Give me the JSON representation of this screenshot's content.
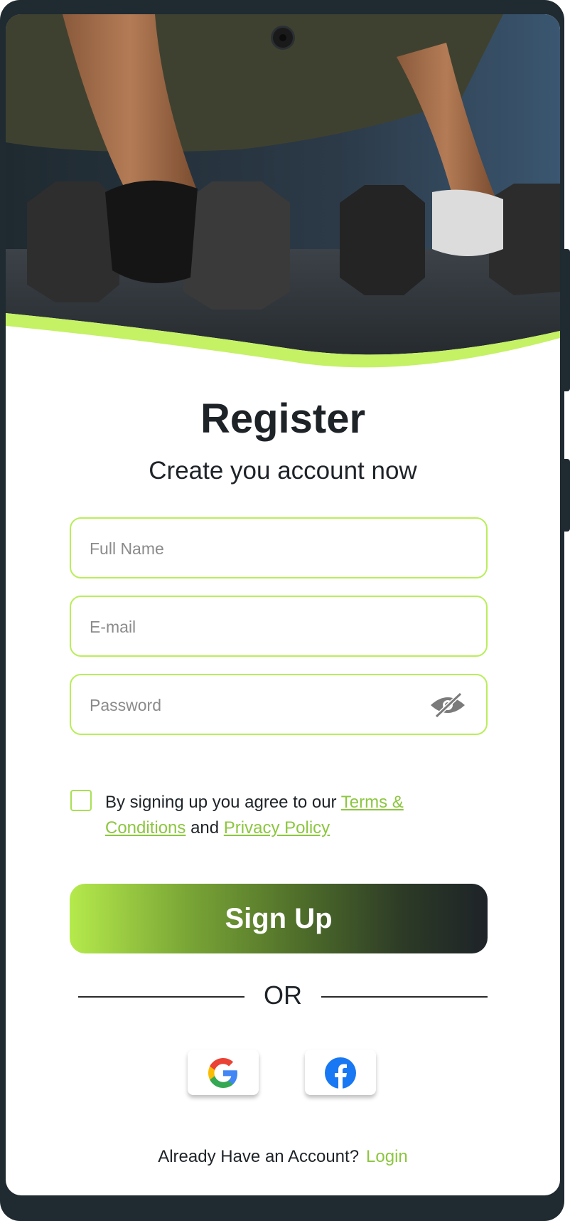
{
  "header": {
    "title": "Register",
    "subtitle": "Create you account now"
  },
  "form": {
    "full_name_placeholder": "Full Name",
    "email_placeholder": "E-mail",
    "password_placeholder": "Password",
    "agree_text": "By signing up you agree to our ",
    "terms_link": "Terms & Conditions",
    "and_text": " and ",
    "privacy_link": "Privacy Policy",
    "signup_label": "Sign Up"
  },
  "divider": {
    "text": "OR"
  },
  "social": {
    "google_icon": "google-icon",
    "facebook_icon": "facebook-icon"
  },
  "footer": {
    "prompt": "Already Have an Account?",
    "login_link": "Login"
  },
  "colors": {
    "accent": "#b9ee5a",
    "link": "#8cc63f",
    "dark": "#1e2328"
  }
}
